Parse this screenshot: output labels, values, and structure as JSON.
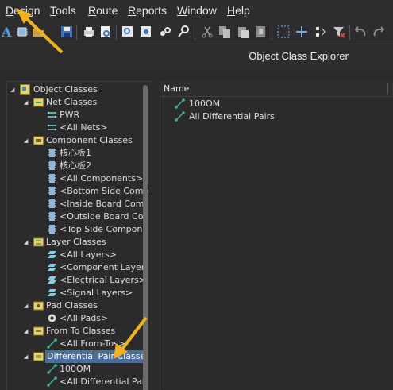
{
  "menu": {
    "items": [
      {
        "id": "design",
        "label": "Design"
      },
      {
        "id": "tools",
        "label": "Tools"
      },
      {
        "id": "route",
        "label": "Route"
      },
      {
        "id": "reports",
        "label": "Reports"
      },
      {
        "id": "window",
        "label": "Window"
      },
      {
        "id": "help",
        "label": "Help"
      }
    ]
  },
  "panel": {
    "title": "Object Class Explorer"
  },
  "tree": {
    "object_classes": "Object Classes",
    "net_classes": "Net Classes",
    "pwr": "PWR",
    "all_nets": "<All Nets>",
    "component_classes": "Component Classes",
    "core_board_1": "核心板1",
    "core_board_2": "核心板2",
    "all_components": "<All Components>",
    "bottom_side": "<Bottom Side Comp",
    "inside_board": "<Inside Board Com",
    "outside_board": "<Outside Board Co",
    "top_side": "<Top Side Compon",
    "layer_classes": "Layer Classes",
    "all_layers": "<All Layers>",
    "component_layer": "<Component Layer",
    "electrical_layers": "<Electrical Layers>",
    "signal_layers": "<Signal Layers>",
    "pad_classes": "Pad Classes",
    "all_pads": "<All Pads>",
    "from_to_classes": "From To Classes",
    "all_from_tos": "<All From-Tos>",
    "diff_pair_classes": "Differential Pair Classe",
    "diff_100om": "100OM",
    "all_diff_pairs": "<All Differential Pai"
  },
  "list": {
    "header_name": "Name",
    "rows": [
      "100OM",
      "All Differential Pairs"
    ]
  },
  "colors": {
    "background": "#2b2b2b",
    "menubar": "#2d2d30",
    "selection": "#4a6d9d",
    "arrow_highlight": "#f2b21b"
  },
  "toolbar_icons": [
    "text-icon",
    "chip-icon",
    "open-folder-icon",
    "save-icon",
    "print-icon",
    "print-preview-icon",
    "zoom-fit-icon",
    "zoom-area-icon",
    "zoom-select-icon",
    "zoom-pointer-icon",
    "cut-icon",
    "copy-icon",
    "paste-icon",
    "rubber-stamp-icon",
    "select-rect-icon",
    "cross-icon",
    "align-icon",
    "clear-filter-icon",
    "undo-icon",
    "redo-icon"
  ]
}
